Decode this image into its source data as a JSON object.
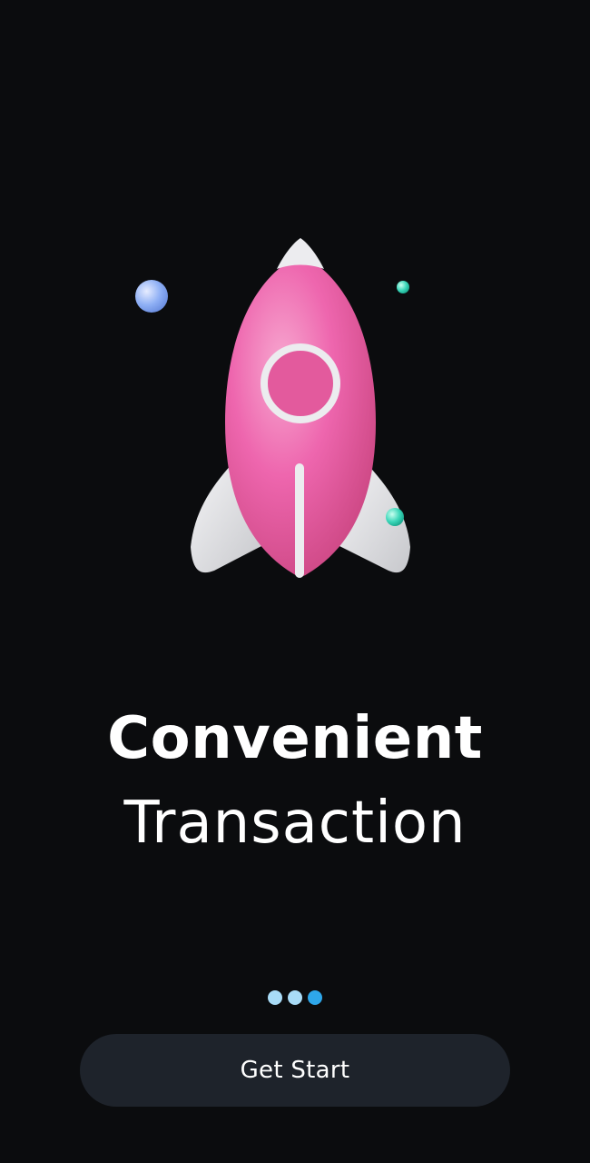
{
  "onboarding": {
    "title_line1": "Convenient",
    "title_line2": "Transaction",
    "page_indicator": {
      "total": 3,
      "current": 3
    },
    "cta_label": "Get Start"
  },
  "icons": {
    "illustration": "rocket-icon",
    "decorations": [
      "planet-icon",
      "star-icon",
      "star-icon"
    ]
  },
  "colors": {
    "background": "#0b0c0e",
    "rocket_body": "#ec5ba5",
    "dot_inactive": "#a9dcf7",
    "dot_active": "#2ea7ea",
    "button_background": "#1e232b",
    "text": "#ffffff"
  }
}
